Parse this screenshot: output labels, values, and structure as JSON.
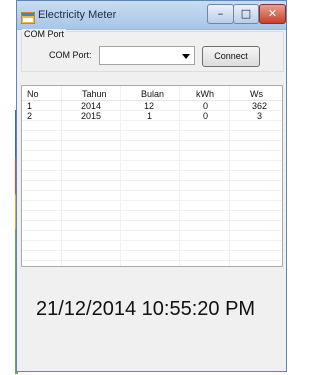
{
  "window": {
    "title": "Electricity Meter"
  },
  "titlebar": {
    "minimize": "–",
    "maximize": "□",
    "close": "✕"
  },
  "groupbox": {
    "title": "COM Port",
    "port_label": "COM Port:",
    "port_value": "",
    "connect_label": "Connect"
  },
  "table": {
    "columns": [
      "No",
      "Tahun",
      "Bulan",
      "kWh",
      "Ws"
    ],
    "rows": [
      [
        "1",
        "2014",
        "12",
        "0",
        "362"
      ],
      [
        "2",
        "2015",
        "1",
        "0",
        "3"
      ]
    ]
  },
  "status": {
    "datetime": "21/12/2014 10:55:20 PM"
  }
}
